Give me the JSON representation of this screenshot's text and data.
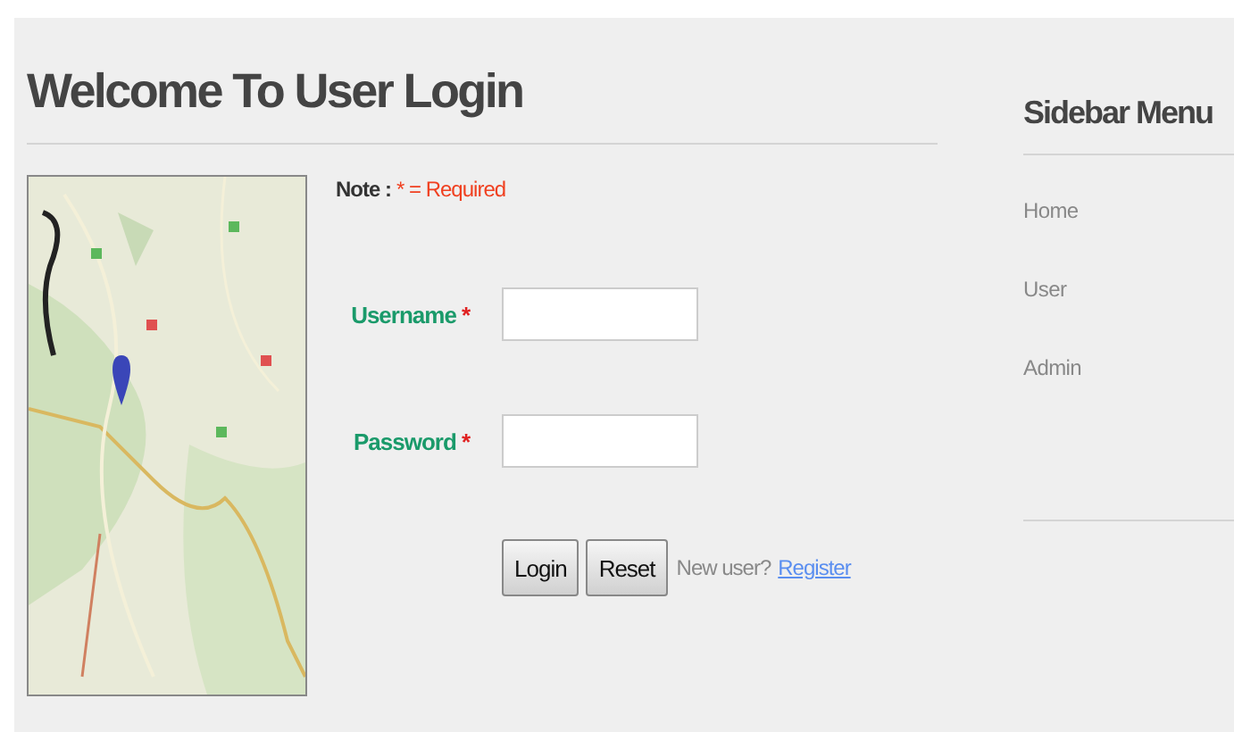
{
  "main": {
    "title": "Welcome To User Login",
    "map": {
      "kind": "picture"
    },
    "note": {
      "label": "Note :",
      "text": "* = Required"
    },
    "fields": [
      {
        "label": "Username",
        "required_mark": "*"
      },
      {
        "label": "Password",
        "required_mark": "*"
      }
    ],
    "buttons": [
      "Login",
      "Reset"
    ],
    "register_prompt": "New user?",
    "register_link": "Register"
  },
  "sidebar": {
    "title": "Sidebar Menu",
    "items": [
      {
        "label": "Home"
      },
      {
        "label": "User"
      },
      {
        "label": "Admin"
      }
    ]
  }
}
